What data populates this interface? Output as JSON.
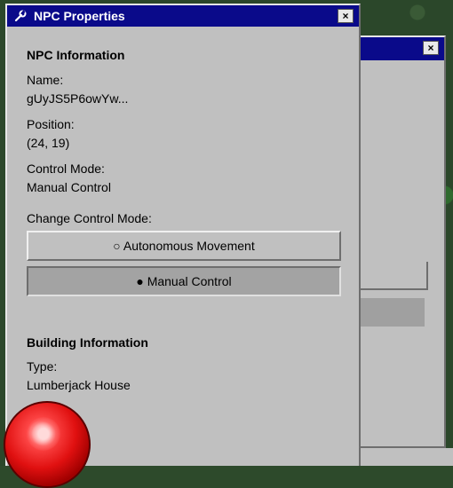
{
  "npc_window": {
    "title": "NPC Properties",
    "close_label": "×",
    "npc_info_heading": "NPC Information",
    "name_label": "Name:",
    "name_value": "gUyJS5P6owYw...",
    "position_label": "Position:",
    "position_value": "(24, 19)",
    "control_mode_label": "Control Mode:",
    "control_mode_value": "Manual Control",
    "change_mode_label": "Change Control Mode:",
    "autonomous_button": "○ Autonomous Movement",
    "manual_button": "● Manual Control",
    "building_heading": "Building Information",
    "type_label": "Type:",
    "type_value": "Lumberjack House"
  },
  "back_window": {
    "close_label": "×"
  },
  "colors": {
    "titlebar": "#0a0a8a",
    "window_bg": "#c0c0c0",
    "pressed_button": "#a3a3a3",
    "orb": "#e01010"
  }
}
